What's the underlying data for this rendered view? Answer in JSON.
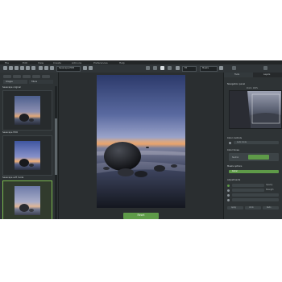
{
  "menu": {
    "items": [
      "File",
      "Edit",
      "View",
      "Create",
      "Add-ons",
      "Preferences",
      "Help"
    ]
  },
  "toolbar": {
    "preset_dropdown": "Seascape-HDR",
    "zoom_value": "Fit",
    "right_dropdown": "Masks"
  },
  "left_panel": {
    "tab_a_label": "Images",
    "tab_b_label": "Filters",
    "presets": [
      {
        "label": "Seascape original"
      },
      {
        "label": "Seascape HDR"
      },
      {
        "label": "Seascape soft mode"
      }
    ]
  },
  "center": {
    "reset_label": "Reset"
  },
  "right_panel": {
    "tab_a_label": "Tools",
    "tab_b_label": "Layers",
    "preview_title": "Navigation panel",
    "zoom_label": "Zoom: 100%",
    "color_section": "Color controls",
    "color_value": "Auto mode",
    "color_tones": "Color tones",
    "tone_value": "Neutral",
    "mask_section": "Masks options",
    "mask_value": "Radial",
    "adjust_section": "Adjustments",
    "opacity_label": "Opacity",
    "strength_label": "Strength",
    "btn_a": "Apply",
    "btn_b": "Undo",
    "btn_c": "Redo"
  },
  "colors": {
    "accent": "#5e9a48",
    "panel": "#2d3234",
    "background": "#2a2e30"
  }
}
